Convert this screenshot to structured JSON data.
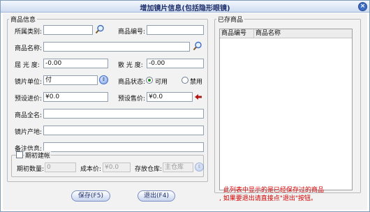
{
  "window": {
    "title": "增加镜片信息(包括隐形眼镜)",
    "close_glyph": "×"
  },
  "info_group": {
    "legend": "商品信息",
    "category_label": "所属类别:",
    "category_value": "",
    "code_label": "商品编号:",
    "code_value": "",
    "name_label": "商品名称:",
    "name_value": "",
    "sphere_label": "屈  光  度:",
    "sphere_value": "-0.00",
    "cylinder_label": "散  光  度:",
    "cylinder_value": "-0.00",
    "unit_label": "镜片单位:",
    "unit_value": "付",
    "status_label": "商品状态:",
    "status_enabled": "可用",
    "status_disabled": "禁用",
    "cost_label": "预设进价:",
    "cost_value": "¥0.0",
    "price_label": "预设售价:",
    "price_value": "¥0.0",
    "fullname_label": "商品全名:",
    "fullname_value": "",
    "origin_label": "镜片产地:",
    "origin_value": "",
    "remark_label": "备注信息:",
    "remark_value": ""
  },
  "initial_group": {
    "legend": "期初建帐",
    "qty_label": "期初数量:",
    "qty_value": "0",
    "cost_label": "成本价:",
    "cost_value": "¥0.0",
    "warehouse_label": "存放仓库:",
    "warehouse_value": "主仓库"
  },
  "existing_group": {
    "legend": "已存商品",
    "columns": [
      "商品编号",
      "商品名称"
    ]
  },
  "buttons": {
    "save": "保存(F5)",
    "exit": "退出(F4)"
  },
  "hint": {
    "line1": "此列表中显示的是已经保存过的商品",
    "line2": ", 如果要退出请直接点\"退出\"按钮。"
  },
  "colors": {
    "hint": "#d40000",
    "title": "#1d2f6b"
  },
  "icons": {
    "search": "search-icon",
    "spin": "dropdown-arrow-icon",
    "price": "arrow-left-icon"
  }
}
